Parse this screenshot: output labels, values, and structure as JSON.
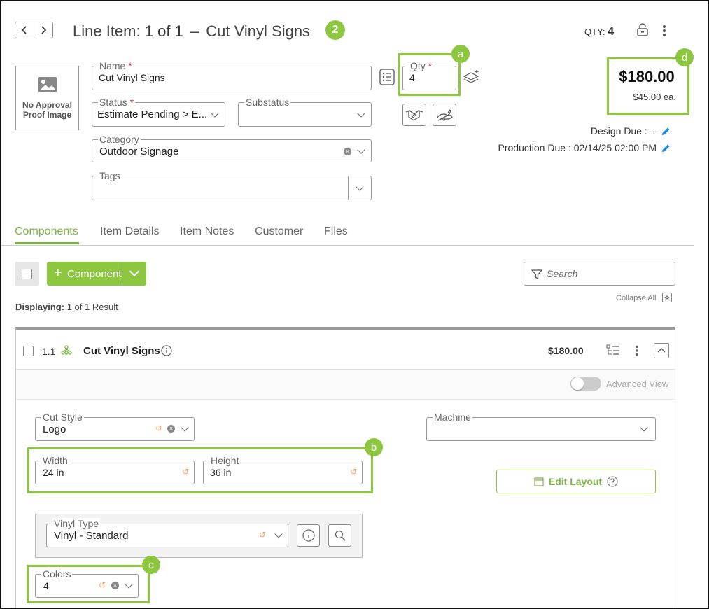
{
  "header": {
    "title_prefix": "Line Item:",
    "position": "1 of 1",
    "dash": "–",
    "item_name": "Cut Vinyl Signs",
    "badge": "2",
    "qty_label": "QTY:",
    "qty_value": "4"
  },
  "image_placeholder": {
    "line1": "No Approval",
    "line2": "Proof Image"
  },
  "form": {
    "name": {
      "label": "Name",
      "value": "Cut Vinyl Signs"
    },
    "status": {
      "label": "Status",
      "value": "Estimate Pending > E..."
    },
    "substatus": {
      "label": "Substatus",
      "value": ""
    },
    "category": {
      "label": "Category",
      "value": "Outdoor Signage"
    },
    "tags": {
      "label": "Tags",
      "value": ""
    },
    "qty": {
      "label": "Qty",
      "value": "4"
    },
    "required_mark": "*"
  },
  "price": {
    "total": "$180.00",
    "each": "$45.00 ea."
  },
  "due": {
    "design": "Design Due : --",
    "production": "Production Due : 02/14/25 02:00 PM"
  },
  "callouts": {
    "a": "a",
    "b": "b",
    "c": "c",
    "d": "d"
  },
  "tabs": [
    "Components",
    "Item Details",
    "Item Notes",
    "Customer",
    "Files"
  ],
  "toolbar": {
    "add_component": "Component",
    "plus": "+",
    "search_placeholder": "Search",
    "collapse_all": "Collapse All",
    "displaying_label": "Displaying:",
    "displaying_value": "1 of 1 Result"
  },
  "component": {
    "number": "1.1",
    "name": "Cut Vinyl Signs",
    "price": "$180.00",
    "advanced_view": "Advanced View",
    "cut_style": {
      "label": "Cut Style",
      "value": "Logo"
    },
    "machine": {
      "label": "Machine",
      "value": ""
    },
    "width": {
      "label": "Width",
      "value": "24 in"
    },
    "height": {
      "label": "Height",
      "value": "36 in"
    },
    "edit_layout": "Edit Layout",
    "vinyl_type": {
      "label": "Vinyl Type",
      "value": "Vinyl - Standard"
    },
    "colors": {
      "label": "Colors",
      "value": "4"
    }
  },
  "colors": {
    "accent": "#8dc63f",
    "tab_active": "#7cb342",
    "link_blue": "#1e88e5",
    "required": "#d32f2f",
    "reset": "#f0a060"
  }
}
